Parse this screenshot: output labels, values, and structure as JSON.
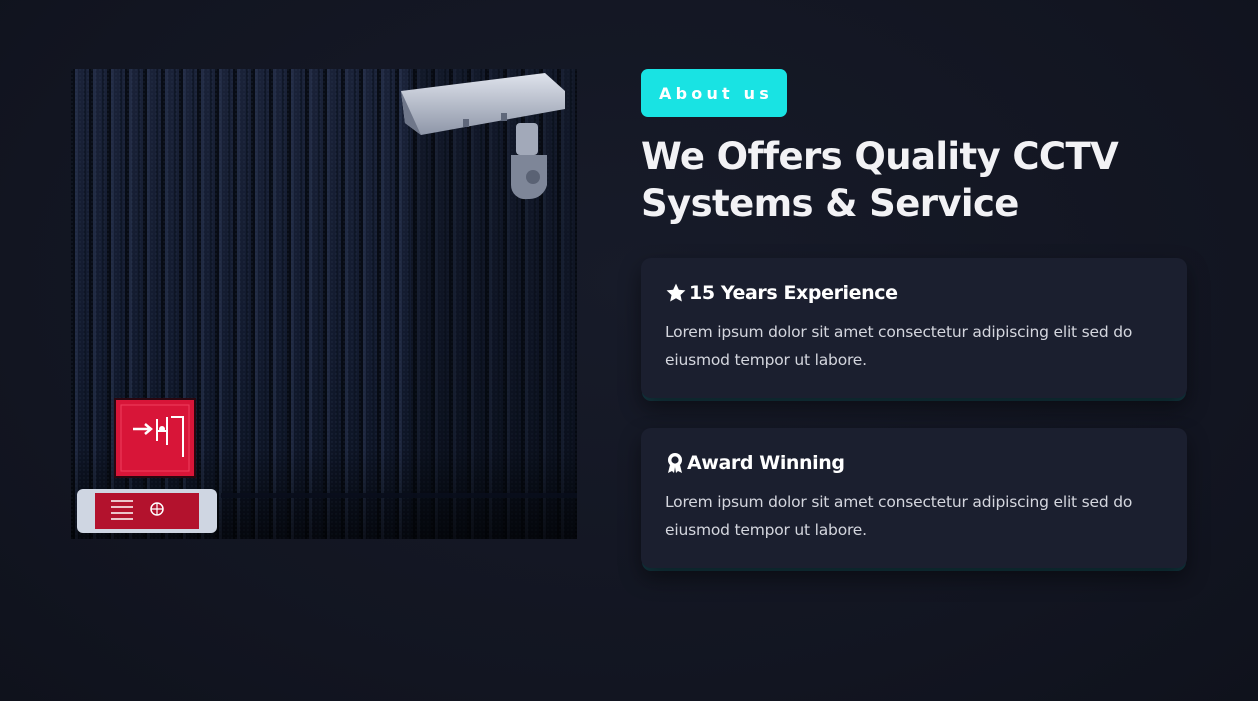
{
  "about": {
    "badge_label": "About us",
    "title_line1": "We Offers Quality CCTV",
    "title_line2": "Systems & Service",
    "photo_alt": "CCTV camera on corrugated wall"
  },
  "features": [
    {
      "icon": "star-icon",
      "title": "15 Years Experience",
      "text": "Lorem ipsum dolor sit amet consectetur adipiscing elit sed do eiusmod tempor ut labore."
    },
    {
      "icon": "award-icon",
      "title": "Award Winning",
      "text": "Lorem ipsum dolor sit amet consectetur adipiscing elit sed do eiusmod tempor ut labore."
    }
  ],
  "colors": {
    "accent": "#19e3e3",
    "background": "#131623",
    "card": "#1b1f2f",
    "text": "#ffffff"
  }
}
